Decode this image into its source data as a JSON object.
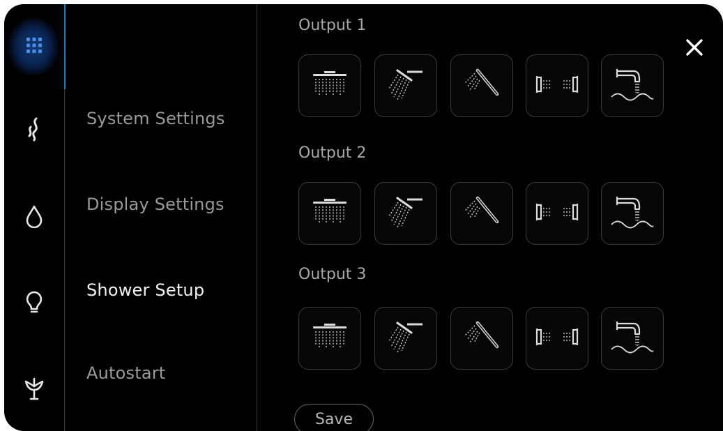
{
  "menu": {
    "items": [
      {
        "label": "System Settings",
        "active": false
      },
      {
        "label": "Display Settings",
        "active": false
      },
      {
        "label": "Shower Setup",
        "active": true
      },
      {
        "label": "Autostart",
        "active": false
      }
    ]
  },
  "rail": {
    "icons": [
      "grid-icon",
      "steam-icon",
      "water-drop-icon",
      "light-bulb-icon",
      "aroma-flower-icon"
    ],
    "accent_color": "#1c7fc6"
  },
  "outputs": [
    {
      "label": "Output 1"
    },
    {
      "label": "Output 2"
    },
    {
      "label": "Output 3"
    }
  ],
  "shower_types": [
    "rain-shower-icon",
    "overhead-shower-icon",
    "hand-shower-icon",
    "body-jets-icon",
    "bath-spout-icon"
  ],
  "actions": {
    "save_label": "Save",
    "close_glyph": "✕"
  }
}
